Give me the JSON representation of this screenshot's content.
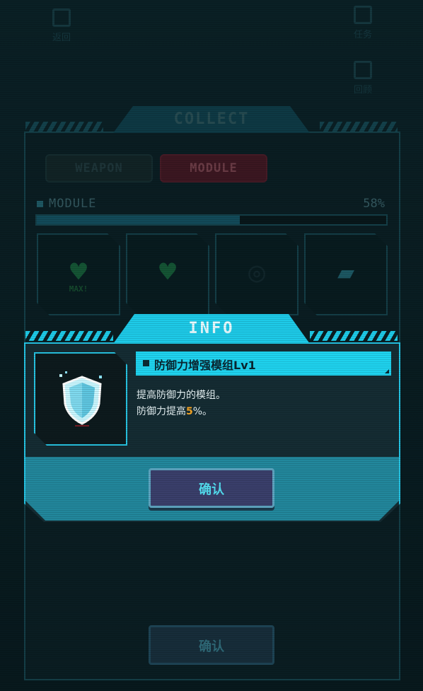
{
  "top_left": {
    "back_label": "返回"
  },
  "top_right": {
    "task_label": "任务",
    "review_label": "回顾"
  },
  "collect": {
    "title": "COLLECT",
    "tabs": {
      "weapon": "WEAPON",
      "module": "MODULE"
    },
    "section_label": "MODULE",
    "progress_percent": 58,
    "progress_text": "58%",
    "slots": [
      {
        "icon": "heart-max-icon",
        "caption": "MAX!"
      },
      {
        "icon": "heart-leaf-icon",
        "caption": ""
      },
      {
        "icon": "locked-swirl-icon",
        "caption": ""
      },
      {
        "icon": "boot-icon",
        "caption": ""
      }
    ]
  },
  "info": {
    "title": "INFO",
    "item_icon": "shield-icon",
    "item_name": "防御力增强模组Lv1",
    "desc_line1": "提高防御力的模组。",
    "desc_line2_prefix": "防御力提高",
    "desc_value": "5",
    "desc_suffix": "%。",
    "confirm_label": "确认"
  },
  "bottom": {
    "confirm_label": "确认"
  },
  "colors": {
    "accent": "#1fd3ef",
    "highlight": "#f5a524",
    "module_tab": "#5a1d2a"
  }
}
